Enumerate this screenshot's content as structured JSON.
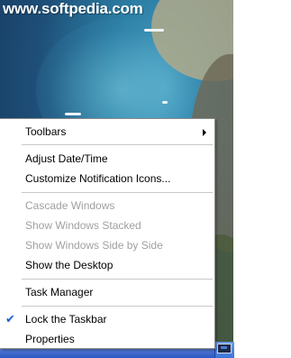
{
  "watermark": "www.softpedia.com",
  "menu": {
    "toolbars": "Toolbars",
    "adjust_date_time": "Adjust Date/Time",
    "customize_notification_icons": "Customize Notification Icons...",
    "cascade_windows": "Cascade Windows",
    "show_windows_stacked": "Show Windows Stacked",
    "show_windows_side_by_side": "Show Windows Side by Side",
    "show_the_desktop": "Show the Desktop",
    "task_manager": "Task Manager",
    "lock_the_taskbar": "Lock the Taskbar",
    "lock_the_taskbar_checked": true,
    "properties": "Properties",
    "check_glyph": "✔",
    "submenu_arrow_icon": "chevron-right-icon"
  },
  "colors": {
    "disabled_text": "#a0a0a0",
    "check_mark": "#1f5fd0",
    "taskbar": "#2c56c2"
  }
}
